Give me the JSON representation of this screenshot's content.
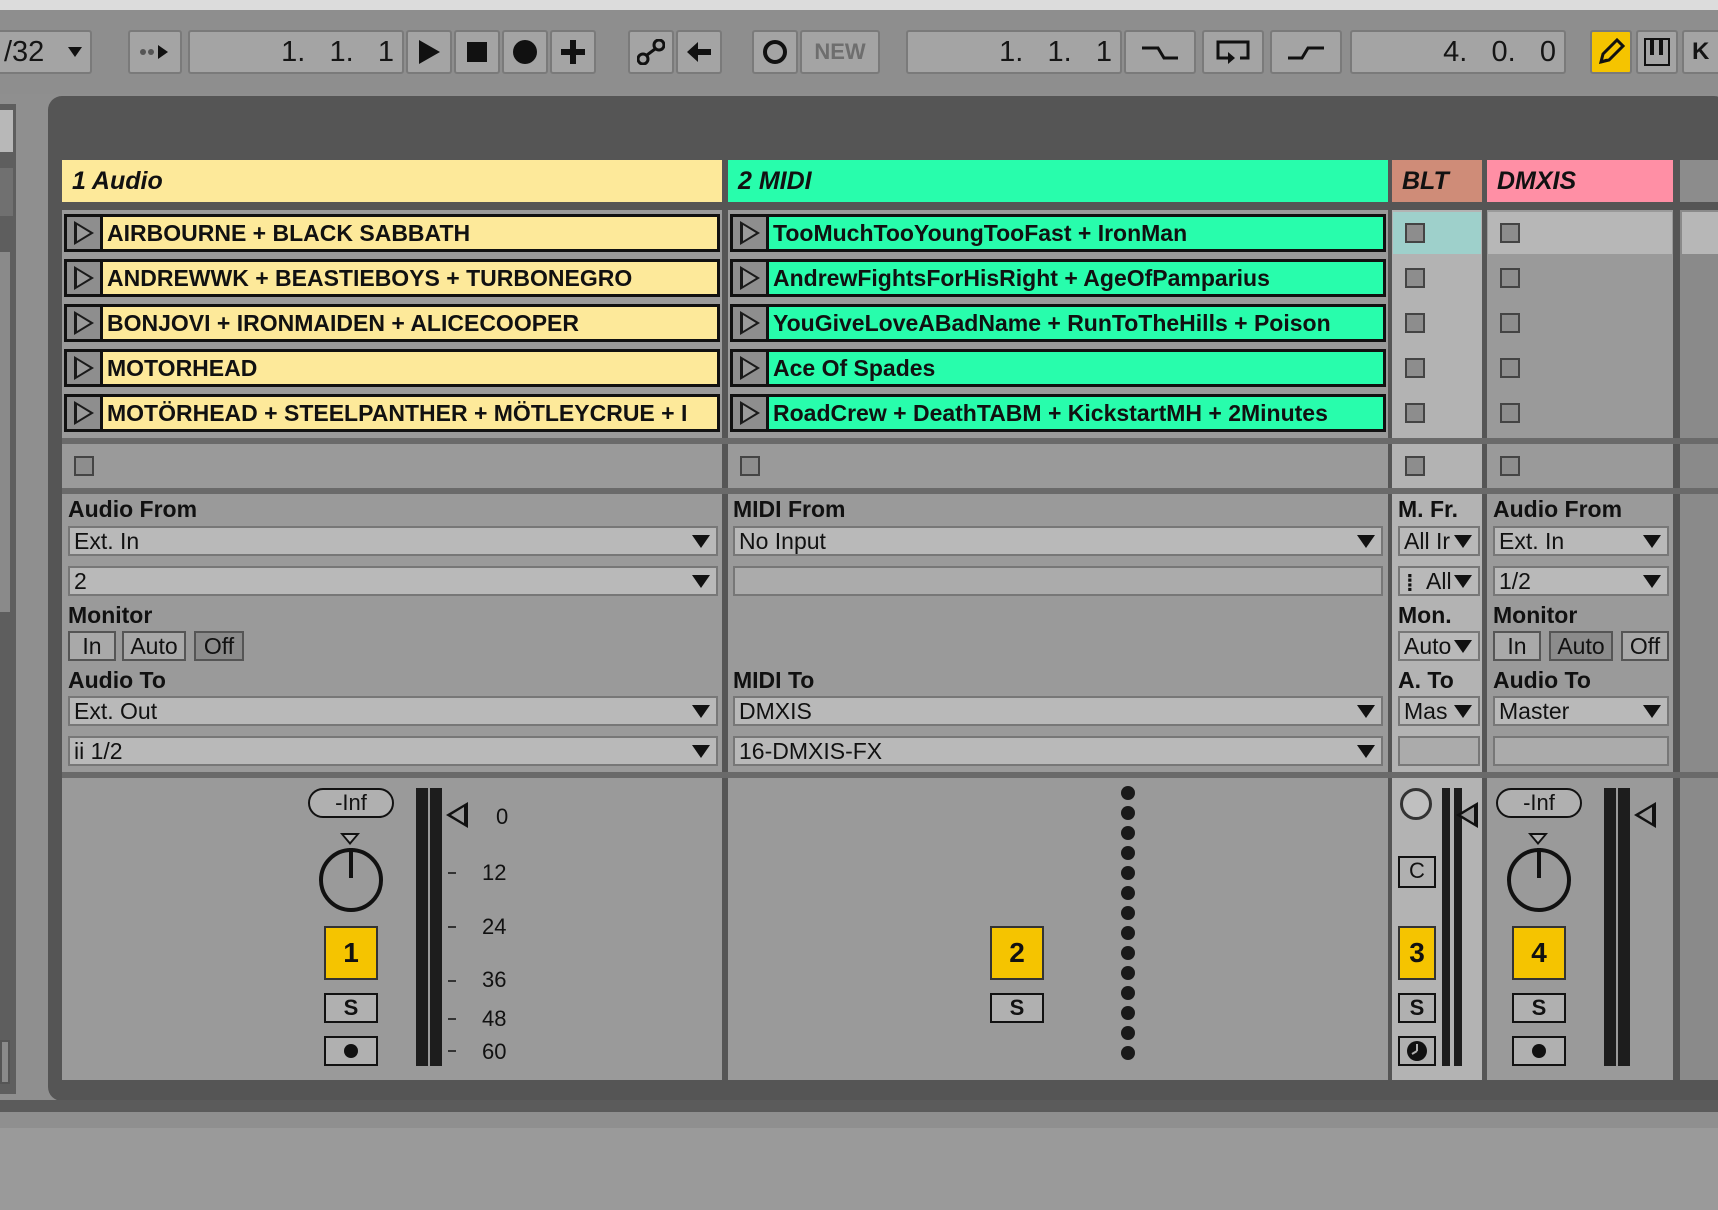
{
  "toolbar": {
    "quantize": "/32",
    "position1": "1.   1.   1",
    "overdub_label": "NEW",
    "position2": "1.   1.   1",
    "length": "4.   0.   0",
    "key_label": "K"
  },
  "colors": {
    "audio_track": "#fde99a",
    "midi_track": "#28fdac",
    "blt_track": "#cf8c78",
    "dmxis_track": "#ff8fa5",
    "track_number": "#f5c400",
    "draw_mode": "#f5c400"
  },
  "tracks": [
    {
      "name": "1 Audio",
      "clips": [
        "AIRBOURNE + BLACK SABBATH",
        "ANDREWWK + BEASTIEBOYS + TURBONEGRO",
        "BONJOVI + IRONMAIDEN + ALICECOOPER",
        "MOTORHEAD",
        "MOTÖRHEAD + STEELPANTHER + MÖTLEYCRUE + I"
      ],
      "io": {
        "from_label": "Audio From",
        "from_type": "Ext. In",
        "from_channel": "2",
        "monitor_label": "Monitor",
        "monitor_in": "In",
        "monitor_auto": "Auto",
        "monitor_off": "Off",
        "to_label": "Audio To",
        "to_type": "Ext. Out",
        "to_channel": "ii 1/2"
      },
      "mixer": {
        "volume": "-Inf",
        "number": "1",
        "solo": "S"
      }
    },
    {
      "name": "2 MIDI",
      "clips": [
        "TooMuchTooYoungTooFast + IronMan",
        "AndrewFightsForHisRight + AgeOfPamparius",
        "YouGiveLoveABadName + RunToTheHills + Poison",
        "Ace Of Spades",
        "RoadCrew + DeathTABM + KickstartMH + 2Minutes"
      ],
      "io": {
        "from_label": "MIDI From",
        "from_type": "No Input",
        "to_label": "MIDI To",
        "to_type": "DMXIS",
        "to_channel": "16-DMXIS-FX"
      },
      "mixer": {
        "number": "2",
        "solo": "S"
      }
    },
    {
      "name": "BLT",
      "io": {
        "from_label": "M. Fr.",
        "from_type": "All Ir",
        "from_channel": "All",
        "monitor_label": "Mon.",
        "monitor_value": "Auto",
        "to_label": "A. To",
        "to_type": "Mas"
      },
      "mixer": {
        "number": "3",
        "solo": "S",
        "crossfade": "C"
      }
    },
    {
      "name": "DMXIS",
      "io": {
        "from_label": "Audio From",
        "from_type": "Ext. In",
        "from_channel": "1/2",
        "monitor_label": "Monitor",
        "monitor_in": "In",
        "monitor_auto": "Auto",
        "monitor_off": "Off",
        "to_label": "Audio To",
        "to_type": "Master"
      },
      "mixer": {
        "volume": "-Inf",
        "number": "4",
        "solo": "S"
      }
    }
  ],
  "meter_scale": [
    "0",
    "12",
    "24",
    "36",
    "48",
    "60"
  ]
}
